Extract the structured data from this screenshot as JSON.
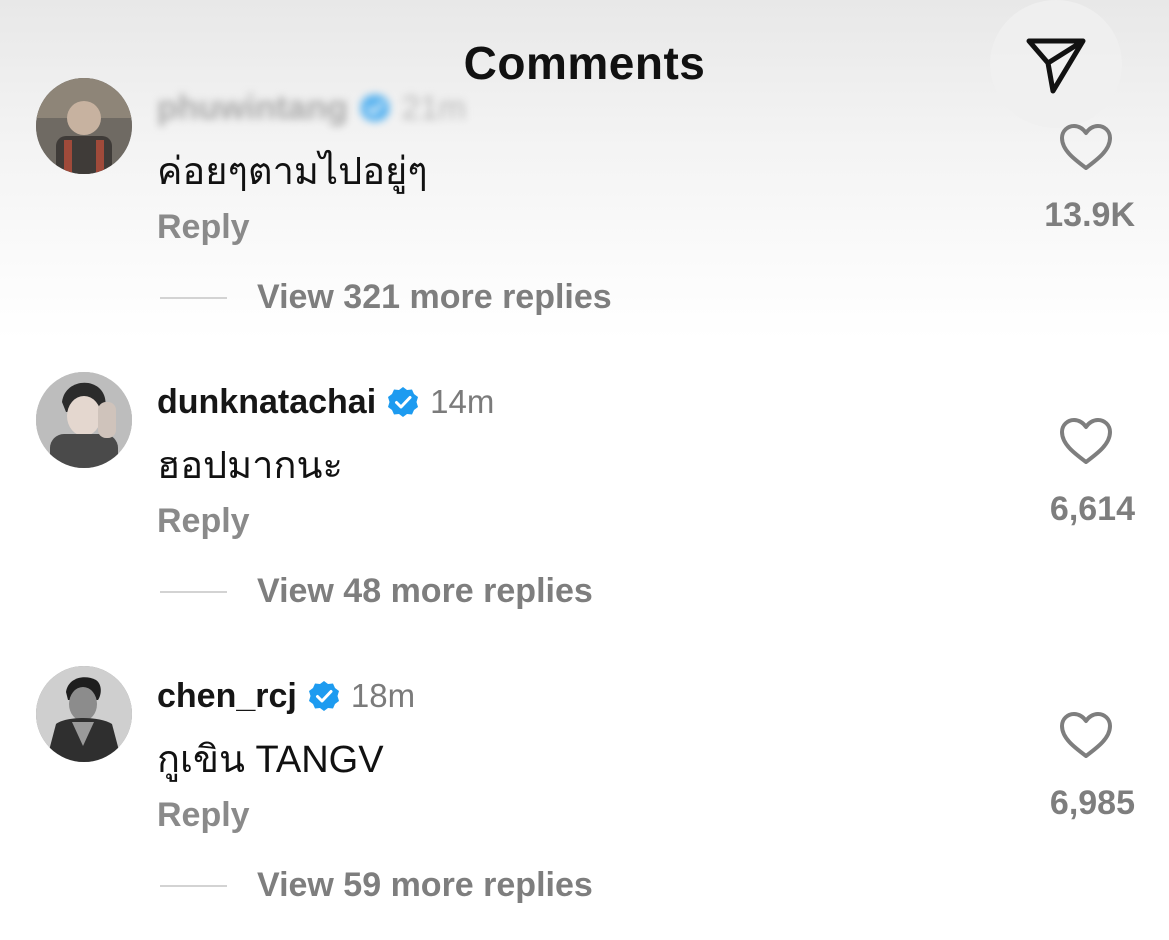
{
  "header": {
    "title": "Comments",
    "send_icon": "paper-plane-icon"
  },
  "colors": {
    "verified_blue": "#1d9bf0",
    "muted_text": "#7e7e7e"
  },
  "comments": [
    {
      "username": "phuwintang",
      "time": "21m",
      "verified": true,
      "text": "ค่อยๆตามไปอยู่ๆ",
      "reply_label": "Reply",
      "likes": "13.9K",
      "view_replies": "View 321 more replies"
    },
    {
      "username": "dunknatachai",
      "time": "14m",
      "verified": true,
      "text": "ฮอปมากนะ",
      "reply_label": "Reply",
      "likes": "6,614",
      "view_replies": "View 48 more replies"
    },
    {
      "username": "chen_rcj",
      "time": "18m",
      "verified": true,
      "text": "กูเขิน TANGV",
      "reply_label": "Reply",
      "likes": "6,985",
      "view_replies": "View 59 more replies"
    }
  ]
}
